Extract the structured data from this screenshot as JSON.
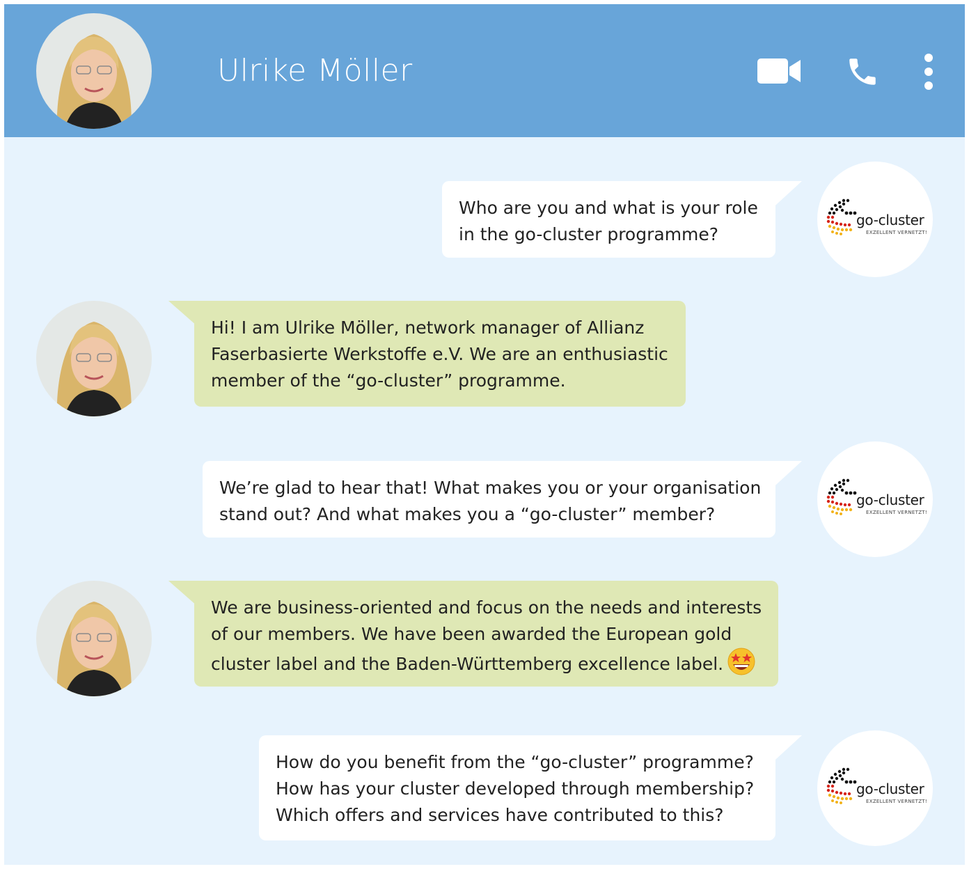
{
  "header": {
    "contact_name": "Ulrike Möller",
    "icons": [
      "video-camera-icon",
      "phone-icon",
      "more-vertical-icon"
    ]
  },
  "colors": {
    "header_bg": "#68a5d9",
    "chat_bg": "#e7f3fd",
    "incoming_bubble": "#dfe8b5",
    "outgoing_bubble": "#ffffff"
  },
  "logo": {
    "name": "go-cluster",
    "tagline": "EXZELLENT VERNETZT!"
  },
  "messages": [
    {
      "direction": "outgoing",
      "lines": [
        "Who are you and what is your role",
        "in the go-cluster programme?"
      ]
    },
    {
      "direction": "incoming",
      "lines": [
        "Hi! I am Ulrike Möller, network manager of Allianz",
        "Faserbasierte Werkstoffe e.V. We are an enthusiastic",
        "member of the “go-cluster” programme."
      ]
    },
    {
      "direction": "outgoing",
      "lines": [
        "We’re glad to hear that! What makes you or your organisation",
        "stand out? And what makes you a “go-cluster” member?"
      ]
    },
    {
      "direction": "incoming",
      "lines": [
        "We are business-oriented and focus on the needs and interests",
        "of our members. We have been awarded the European gold",
        "cluster label and the Baden-Württemberg excellence label."
      ],
      "emoji": "star-struck-emoji"
    },
    {
      "direction": "outgoing",
      "lines": [
        "How do you benefit from the “go-cluster” programme?",
        "How has your cluster developed through membership?",
        "Which offers and services have contributed to this?"
      ]
    }
  ]
}
